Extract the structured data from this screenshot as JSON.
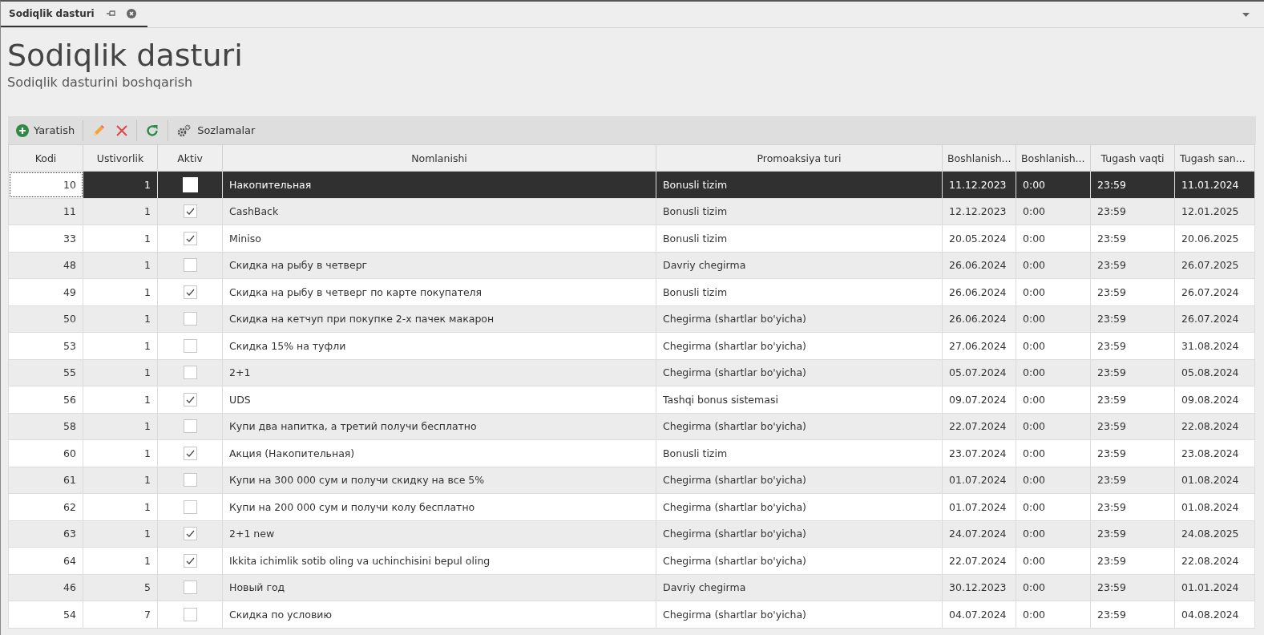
{
  "tab": {
    "label": "Sodiqlik dasturi",
    "selected": true
  },
  "header": {
    "title": "Sodiqlik dasturi",
    "subtitle": "Sodiqlik dasturini boshqarish"
  },
  "toolbar": [
    {
      "kind": "create",
      "label": "Yaratish"
    },
    {
      "kind": "edit"
    },
    {
      "kind": "delete"
    },
    {
      "kind": "refresh"
    },
    {
      "kind": "settings",
      "label": "Sozlamalar"
    }
  ],
  "table": {
    "columns": [
      "Kodi",
      "Ustivorlik",
      "Aktiv",
      "Nomlanishi",
      "Promoaksiya turi",
      "Boshlanish...",
      "Boshlanish...",
      "Tugash vaqti",
      "Tugash san..."
    ],
    "rows": [
      {
        "code": "10",
        "priority": "1",
        "active": false,
        "name": "Накопительная",
        "promo": "Bonusli tizim",
        "start_date": "11.12.2023",
        "start_time": "0:00",
        "end_time": "23:59",
        "end_date": "11.01.2024",
        "selected": true
      },
      {
        "code": "11",
        "priority": "1",
        "active": true,
        "name": "CashBack",
        "promo": "Bonusli tizim",
        "start_date": "12.12.2023",
        "start_time": "0:00",
        "end_time": "23:59",
        "end_date": "12.01.2025",
        "selected": false
      },
      {
        "code": "33",
        "priority": "1",
        "active": true,
        "name": "Miniso",
        "promo": "Bonusli tizim",
        "start_date": "20.05.2024",
        "start_time": "0:00",
        "end_time": "23:59",
        "end_date": "20.06.2025",
        "selected": false
      },
      {
        "code": "48",
        "priority": "1",
        "active": false,
        "name": "Скидка на рыбу в четверг",
        "promo": "Davriy chegirma",
        "start_date": "26.06.2024",
        "start_time": "0:00",
        "end_time": "23:59",
        "end_date": "26.07.2025",
        "selected": false
      },
      {
        "code": "49",
        "priority": "1",
        "active": true,
        "name": "Скидка на рыбу в четверг по карте покупателя",
        "promo": "Bonusli tizim",
        "start_date": "26.06.2024",
        "start_time": "0:00",
        "end_time": "23:59",
        "end_date": "26.07.2024",
        "selected": false
      },
      {
        "code": "50",
        "priority": "1",
        "active": false,
        "name": "Скидка на кетчуп при покупке 2-х пачек макарон",
        "promo": "Chegirma (shartlar bo'yicha)",
        "start_date": "26.06.2024",
        "start_time": "0:00",
        "end_time": "23:59",
        "end_date": "26.07.2024",
        "selected": false
      },
      {
        "code": "53",
        "priority": "1",
        "active": false,
        "name": "Скидка 15% на туфли",
        "promo": "Chegirma (shartlar bo'yicha)",
        "start_date": "27.06.2024",
        "start_time": "0:00",
        "end_time": "23:59",
        "end_date": "31.08.2024",
        "selected": false
      },
      {
        "code": "55",
        "priority": "1",
        "active": false,
        "name": "2+1",
        "promo": "Chegirma (shartlar bo'yicha)",
        "start_date": "05.07.2024",
        "start_time": "0:00",
        "end_time": "23:59",
        "end_date": "05.08.2024",
        "selected": false
      },
      {
        "code": "56",
        "priority": "1",
        "active": true,
        "name": "UDS",
        "promo": "Tashqi bonus sistemasi",
        "start_date": "09.07.2024",
        "start_time": "0:00",
        "end_time": "23:59",
        "end_date": "09.08.2024",
        "selected": false
      },
      {
        "code": "58",
        "priority": "1",
        "active": false,
        "name": "Купи два напитка, а третий получи бесплатно",
        "promo": "Chegirma (shartlar bo'yicha)",
        "start_date": "22.07.2024",
        "start_time": "0:00",
        "end_time": "23:59",
        "end_date": "22.08.2024",
        "selected": false
      },
      {
        "code": "60",
        "priority": "1",
        "active": true,
        "name": "Акция (Накопительная)",
        "promo": "Bonusli tizim",
        "start_date": "23.07.2024",
        "start_time": "0:00",
        "end_time": "23:59",
        "end_date": "23.08.2024",
        "selected": false
      },
      {
        "code": "61",
        "priority": "1",
        "active": false,
        "name": "Купи на 300 000 сум и получи скидку на все 5%",
        "promo": "Chegirma (shartlar bo'yicha)",
        "start_date": "01.07.2024",
        "start_time": "0:00",
        "end_time": "23:59",
        "end_date": "01.08.2024",
        "selected": false
      },
      {
        "code": "62",
        "priority": "1",
        "active": false,
        "name": "Купи на 200 000 сум и получи колу бесплатно",
        "promo": "Chegirma (shartlar bo'yicha)",
        "start_date": "01.07.2024",
        "start_time": "0:00",
        "end_time": "23:59",
        "end_date": "01.08.2024",
        "selected": false
      },
      {
        "code": "63",
        "priority": "1",
        "active": true,
        "name": "2+1 new",
        "promo": "Chegirma (shartlar bo'yicha)",
        "start_date": "24.07.2024",
        "start_time": "0:00",
        "end_time": "23:59",
        "end_date": "24.08.2025",
        "selected": false
      },
      {
        "code": "64",
        "priority": "1",
        "active": true,
        "name": "Ikkita ichimlik sotib oling va uchinchisini bepul oling",
        "promo": "Chegirma (shartlar bo'yicha)",
        "start_date": "22.07.2024",
        "start_time": "0:00",
        "end_time": "23:59",
        "end_date": "22.08.2024",
        "selected": false
      },
      {
        "code": "46",
        "priority": "5",
        "active": false,
        "name": "Новый год",
        "promo": "Davriy chegirma",
        "start_date": "30.12.2023",
        "start_time": "0:00",
        "end_time": "23:59",
        "end_date": "01.01.2024",
        "selected": false
      },
      {
        "code": "54",
        "priority": "7",
        "active": false,
        "name": "Скидка по условию",
        "promo": "Chegirma (shartlar bo'yicha)",
        "start_date": "04.07.2024",
        "start_time": "0:00",
        "end_time": "23:59",
        "end_date": "04.08.2024",
        "selected": false
      }
    ]
  }
}
